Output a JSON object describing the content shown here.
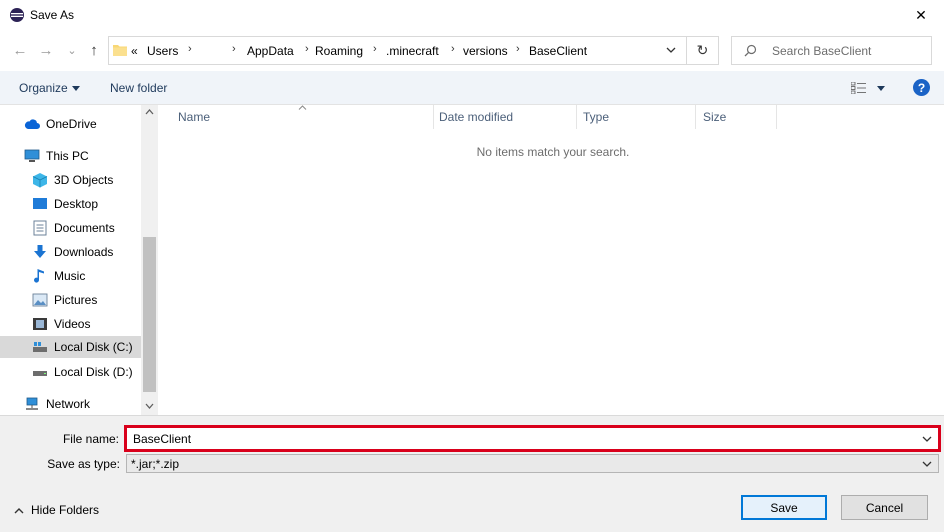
{
  "window": {
    "title": "Save As",
    "close_glyph": "✕"
  },
  "nav": {
    "back_glyph": "←",
    "forward_glyph": "→",
    "recent_glyph": "⌄",
    "up_glyph": "↑",
    "refresh_glyph": "↻",
    "breadcrumbs": [
      "«",
      "Users",
      "›",
      "›",
      "AppData",
      "›",
      "Roaming",
      "›",
      ".minecraft",
      "›",
      "versions",
      "›",
      "BaseClient"
    ]
  },
  "search": {
    "placeholder": "Search BaseClient"
  },
  "commands": {
    "organize": "Organize",
    "new_folder": "New folder",
    "help": "?"
  },
  "sidebar": {
    "items": [
      {
        "label": "OneDrive",
        "icon": "cloud-icon"
      },
      {
        "label": "This PC",
        "icon": "computer-icon"
      },
      {
        "label": "3D Objects",
        "icon": "cube-icon"
      },
      {
        "label": "Desktop",
        "icon": "desktop-icon"
      },
      {
        "label": "Documents",
        "icon": "document-icon"
      },
      {
        "label": "Downloads",
        "icon": "download-arrow-icon"
      },
      {
        "label": "Music",
        "icon": "music-note-icon"
      },
      {
        "label": "Pictures",
        "icon": "picture-icon"
      },
      {
        "label": "Videos",
        "icon": "film-icon"
      },
      {
        "label": "Local Disk (C:)",
        "icon": "drive-icon",
        "selected": true
      },
      {
        "label": "Local Disk (D:)",
        "icon": "drive-icon"
      },
      {
        "label": "Network",
        "icon": "network-icon"
      }
    ]
  },
  "columns": [
    "Name",
    "Date modified",
    "Type",
    "Size"
  ],
  "empty_message": "No items match your search.",
  "bottom": {
    "file_name_label": "File name:",
    "file_name_value": "BaseClient",
    "save_type_label": "Save as type:",
    "save_type_value": "*.jar;*.zip",
    "hide_folders": "Hide Folders",
    "save_button": "Save",
    "cancel_button": "Cancel"
  },
  "colors": {
    "accent": "#0078d7",
    "highlight_border": "#d9001b",
    "command_text": "#1e395b"
  }
}
